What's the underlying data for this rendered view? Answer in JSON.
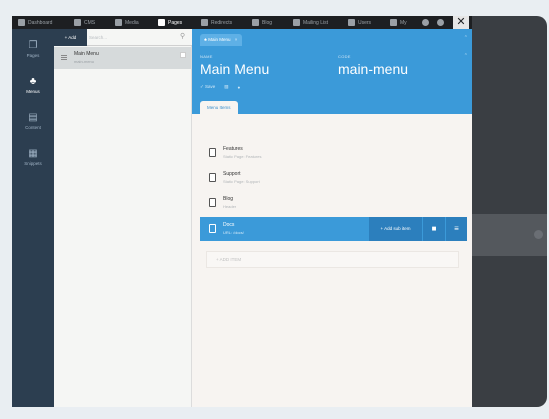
{
  "topnav": {
    "items": [
      {
        "label": "Dashboard",
        "icon": "dashboard-icon"
      },
      {
        "label": "CMS",
        "icon": "pen-icon"
      },
      {
        "label": "Media",
        "icon": "media-icon"
      },
      {
        "label": "Pages",
        "icon": "pages-icon"
      },
      {
        "label": "Redirects",
        "icon": "redirects-icon"
      },
      {
        "label": "Blog",
        "icon": "blog-icon"
      },
      {
        "label": "Mailing List",
        "icon": "mail-icon"
      },
      {
        "label": "Users",
        "icon": "users-icon"
      },
      {
        "label": "My",
        "icon": "account-icon"
      }
    ],
    "active": "Pages",
    "close_glyph": "✕"
  },
  "sidebar": {
    "items": [
      {
        "label": "Pages",
        "icon": "pages-icon",
        "glyph": "❐"
      },
      {
        "label": "Menus",
        "icon": "sitemap-icon",
        "glyph": "♣"
      },
      {
        "label": "Content",
        "icon": "document-icon",
        "glyph": "▤"
      },
      {
        "label": "Snippets",
        "icon": "snippets-icon",
        "glyph": "▦"
      }
    ],
    "active": "Menus"
  },
  "list": {
    "add_label": "+ Add",
    "search_placeholder": "Search...",
    "items": [
      {
        "name": "Main Menu",
        "code": "main-menu"
      }
    ]
  },
  "editor": {
    "tab_label": "Main Menu",
    "name_label": "NAME",
    "name_value": "Main Menu",
    "code_label": "CODE",
    "code_value": "main-menu",
    "save_label": "✓ Save",
    "subtab_label": "Menu Items",
    "items": [
      {
        "title": "Features",
        "subtitle": "Static Page: Features"
      },
      {
        "title": "Support",
        "subtitle": "Static Page: Support"
      },
      {
        "title": "Blog",
        "subtitle": "Header"
      },
      {
        "title": "Docs",
        "subtitle": "URL: /docs/"
      }
    ],
    "selected_index": 3,
    "add_subitem_label": "+ Add sub item",
    "add_item_label": "+ ADD ITEM"
  },
  "colors": {
    "accent": "#3b9ad9",
    "sidebar": "#2c3e50",
    "topbar": "#1d1f22"
  }
}
